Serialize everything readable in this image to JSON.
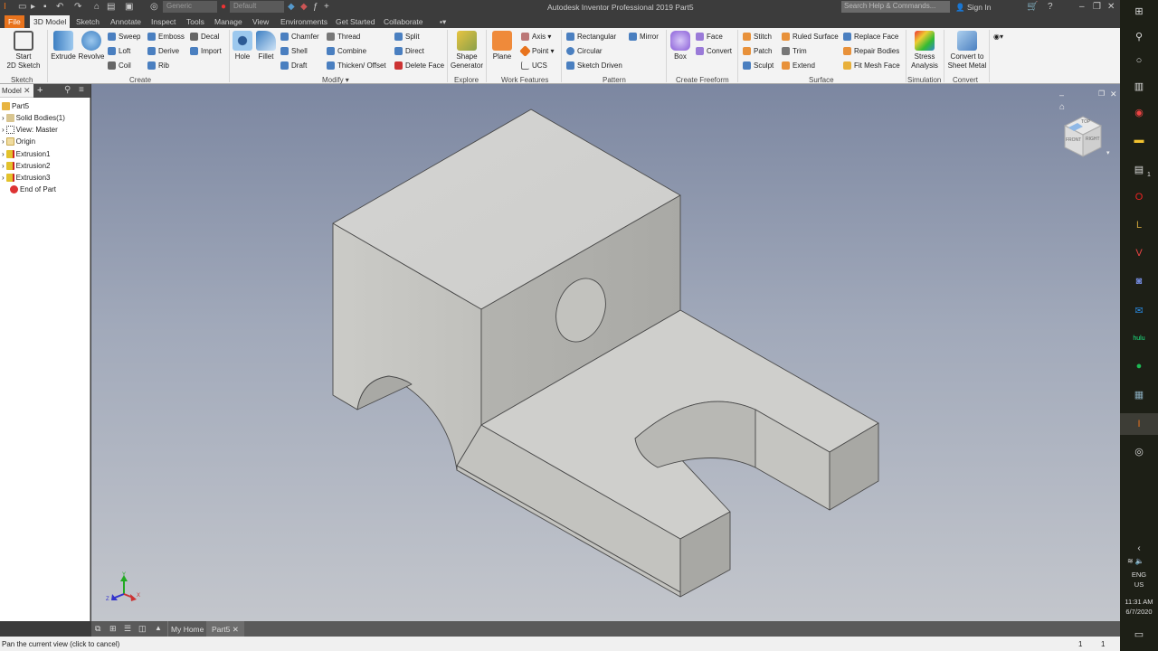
{
  "titlebar": {
    "app_title": "Autodesk Inventor Professional 2019   Part5",
    "material_combo": "Generic",
    "appearance_combo": "Default",
    "search_placeholder": "Search Help & Commands...",
    "sign_in": "Sign In"
  },
  "ribbon_tabs": [
    "File",
    "3D Model",
    "Sketch",
    "Annotate",
    "Inspect",
    "Tools",
    "Manage",
    "View",
    "Environments",
    "Get Started",
    "Collaborate"
  ],
  "ribbon": {
    "sketch": {
      "start_line1": "Start",
      "start_line2": "2D Sketch",
      "panel": "Sketch"
    },
    "create": {
      "extrude": "Extrude",
      "revolve": "Revolve",
      "sweep": "Sweep",
      "loft": "Loft",
      "coil": "Coil",
      "emboss": "Emboss",
      "derive": "Derive",
      "rib": "Rib",
      "decal": "Decal",
      "import": "Import",
      "panel": "Create"
    },
    "modify": {
      "hole": "Hole",
      "fillet": "Fillet",
      "chamfer": "Chamfer",
      "shell": "Shell",
      "draft": "Draft",
      "thread": "Thread",
      "combine": "Combine",
      "thicken": "Thicken/ Offset",
      "split": "Split",
      "direct": "Direct",
      "delete_face": "Delete Face",
      "panel": "Modify ▾"
    },
    "explore": {
      "shape1": "Shape",
      "shape2": "Generator",
      "panel": "Explore"
    },
    "work_features": {
      "plane": "Plane",
      "axis": "Axis ▾",
      "point": "Point ▾",
      "ucs": "UCS",
      "panel": "Work Features"
    },
    "pattern": {
      "rectangular": "Rectangular",
      "circular": "Circular",
      "sketch_driven": "Sketch Driven",
      "mirror": "Mirror",
      "panel": "Pattern"
    },
    "freeform": {
      "box": "Box",
      "face": "Face",
      "convert": "Convert",
      "panel": "Create Freeform"
    },
    "surface": {
      "stitch": "Stitch",
      "patch": "Patch",
      "sculpt": "Sculpt",
      "ruled": "Ruled Surface",
      "trim": "Trim",
      "extend": "Extend",
      "replace": "Replace Face",
      "repair": "Repair Bodies",
      "fitmesh": "Fit Mesh Face",
      "panel": "Surface"
    },
    "simulation": {
      "l1": "Stress",
      "l2": "Analysis",
      "panel": "Simulation"
    },
    "convert": {
      "l1": "Convert to",
      "l2": "Sheet Metal",
      "panel": "Convert"
    }
  },
  "browser": {
    "tab": "Model",
    "items": [
      {
        "label": "Part5"
      },
      {
        "label": "Solid Bodies(1)"
      },
      {
        "label": "View: Master"
      },
      {
        "label": "Origin"
      },
      {
        "label": "Extrusion1"
      },
      {
        "label": "Extrusion2"
      },
      {
        "label": "Extrusion3"
      },
      {
        "label": "End of Part"
      }
    ]
  },
  "viewcube": {
    "top": "TOP",
    "front": "FRONT",
    "right": "RIGHT"
  },
  "triad": {
    "x": "X",
    "y": "Y",
    "z": "Z"
  },
  "doc_tabs": {
    "home": "My Home",
    "part": "Part5"
  },
  "status": {
    "message": "Pan the current view (click to cancel)",
    "count1": "1",
    "count2": "1"
  },
  "taskbar": {
    "lang1": "ENG",
    "lang2": "US",
    "time": "11:31 AM",
    "date": "6/7/2020",
    "badge": "1"
  },
  "colors": {
    "file_tab": "#e8731d",
    "viewport_top": "#7c87a1",
    "viewport_bottom": "#c3c6cc",
    "model_face": "#d2d2cf"
  }
}
